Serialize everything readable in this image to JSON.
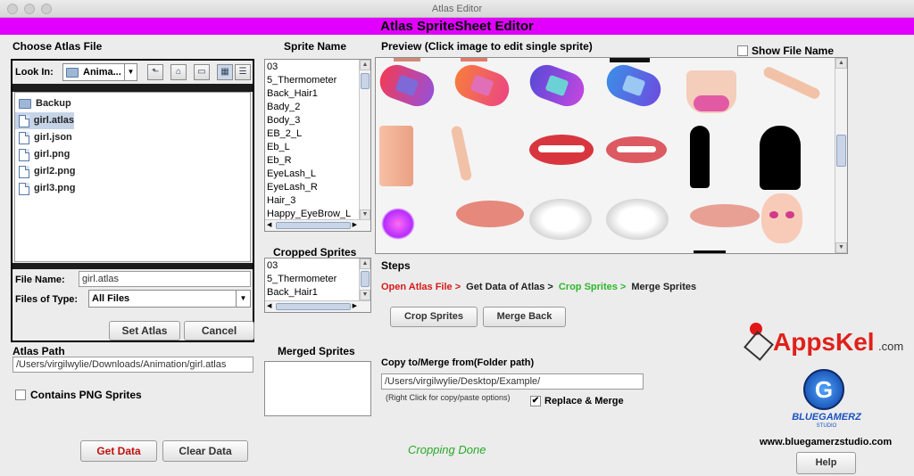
{
  "window": {
    "title": "Atlas Editor"
  },
  "banner": {
    "title": "Atlas SpriteSheet Editor"
  },
  "chooser": {
    "heading": "Choose Atlas File",
    "look_in_label": "Look In:",
    "look_in_value": "Anima...",
    "files": [
      {
        "name": "Backup",
        "kind": "folder"
      },
      {
        "name": "girl.atlas",
        "kind": "file",
        "selected": true
      },
      {
        "name": "girl.json",
        "kind": "file"
      },
      {
        "name": "girl.png",
        "kind": "file"
      },
      {
        "name": "girl2.png",
        "kind": "file"
      },
      {
        "name": "girl3.png",
        "kind": "file"
      }
    ],
    "file_name_label": "File Name:",
    "file_name_value": "girl.atlas",
    "files_of_type_label": "Files of Type:",
    "files_of_type_value": "All Files",
    "set_atlas_label": "Set Atlas",
    "cancel_label": "Cancel"
  },
  "atlas_path": {
    "label": "Atlas Path",
    "value": "/Users/virgilwylie/Downloads/Animation/girl.atlas"
  },
  "contains_png": {
    "label": "Contains PNG Sprites",
    "checked": false
  },
  "bottom_buttons": {
    "get_data": "Get Data",
    "clear_data": "Clear Data"
  },
  "sprite_name": {
    "heading": "Sprite Name",
    "items": [
      "03",
      "5_Thermometer",
      "Back_Hair1",
      "Bady_2",
      "Body_3",
      "EB_2_L",
      "Eb_L",
      "Eb_R",
      "EyeLash_L",
      "EyeLash_R",
      "Hair_3",
      "Happy_EyeBrow_L"
    ]
  },
  "cropped": {
    "heading": "Cropped Sprites",
    "items": [
      "03",
      "5_Thermometer",
      "Back_Hair1"
    ]
  },
  "merged": {
    "heading": "Merged Sprites"
  },
  "preview": {
    "heading": "Preview (Click image to edit single sprite)",
    "show_file_name_label": "Show File Name",
    "show_file_name_checked": false
  },
  "steps": {
    "heading": "Steps",
    "flow": [
      {
        "text": "Open Atlas File >",
        "color": "#d61a1a"
      },
      {
        "text": "Get Data of Atlas >",
        "color": "#222222"
      },
      {
        "text": "Crop Sprites >",
        "color": "#2db82d"
      },
      {
        "text": "Merge Sprites",
        "color": "#222222"
      }
    ],
    "crop_button": "Crop Sprites",
    "merge_button": "Merge Back"
  },
  "copy_merge": {
    "label": "Copy to/Merge from(Folder path)",
    "value": "/Users/virgilwylie/Desktop/Example/",
    "hint": "(Right Click for copy/paste options)",
    "replace_label": "Replace & Merge",
    "replace_checked": true
  },
  "status": {
    "text": "Cropping Done",
    "color": "#2aa82a"
  },
  "branding": {
    "appskel": "AppsKel",
    "appskel_suffix": ".com",
    "bluegamerz": "BLUEGAMERZ",
    "studio": "STUDIO",
    "website": "www.bluegamerzstudio.com",
    "help": "Help"
  }
}
